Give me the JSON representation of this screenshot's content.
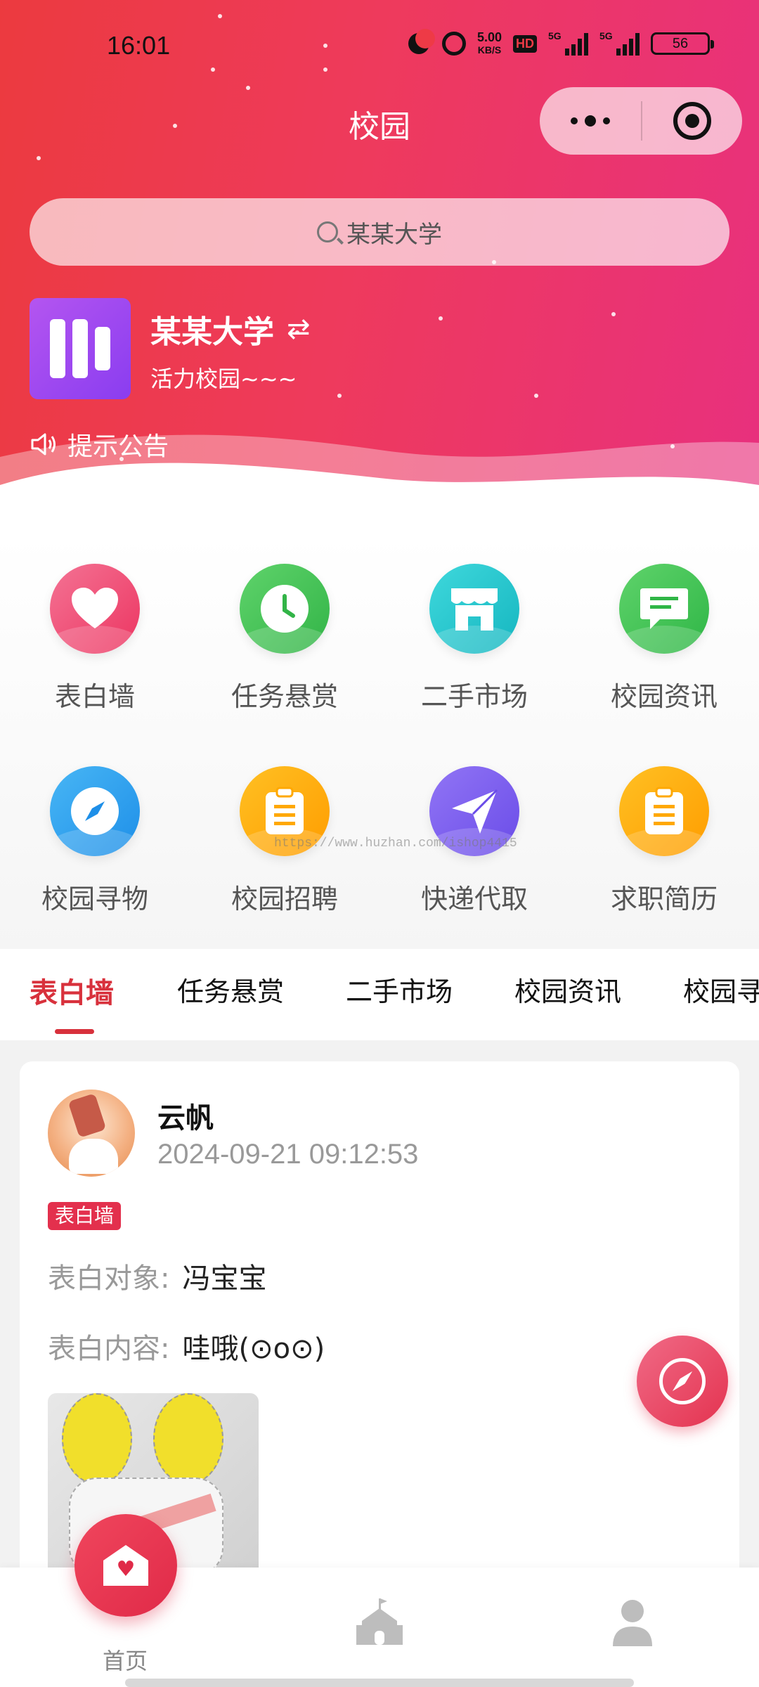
{
  "status_bar": {
    "time": "16:01",
    "net_speed_value": "5.00",
    "net_speed_unit": "KB/S",
    "hd_badge": "HD",
    "signal1_label": "5G",
    "signal2_label": "5G",
    "battery": "56"
  },
  "nav": {
    "title": "校园",
    "more_icon": "more-dots-icon",
    "close_icon": "target-close-icon"
  },
  "search": {
    "placeholder": "某某大学"
  },
  "school": {
    "name": "某某大学",
    "switch_icon": "⇄",
    "slogan": "活力校园~~~",
    "notice": "提示公告"
  },
  "grid": [
    {
      "label": "表白墙",
      "icon": "heart-icon",
      "color": "#ef4a72"
    },
    {
      "label": "任务悬赏",
      "icon": "clock-icon",
      "color": "#44c05a"
    },
    {
      "label": "二手市场",
      "icon": "shop-icon",
      "color": "#21c3cc"
    },
    {
      "label": "校园资讯",
      "icon": "chat-icon",
      "color": "#3fc65a"
    },
    {
      "label": "校园寻物",
      "icon": "compass-icon",
      "color": "#2f9ff0"
    },
    {
      "label": "校园招聘",
      "icon": "clipboard-icon",
      "color": "#ffaa00"
    },
    {
      "label": "快递代取",
      "icon": "send-icon",
      "color": "#7a5cf0"
    },
    {
      "label": "求职简历",
      "icon": "clipboard-icon",
      "color": "#ffaa00"
    }
  ],
  "tabs": [
    "表白墙",
    "任务悬赏",
    "二手市场",
    "校园资讯",
    "校园寻"
  ],
  "post": {
    "user": "云帆",
    "time": "2024-09-21 09:12:53",
    "tag": "表白墙",
    "target_label": "表白对象:",
    "target_value": "冯宝宝",
    "content_label": "表白内容:",
    "content_value": "哇哦(⊙o⊙)"
  },
  "bottom_nav": {
    "home_label": "首页"
  },
  "watermark": "https://www.huzhan.com/ishop4415",
  "colors": {
    "accent": "#d8313c",
    "header_start": "#ec3a3f",
    "header_end": "#e8307e"
  }
}
